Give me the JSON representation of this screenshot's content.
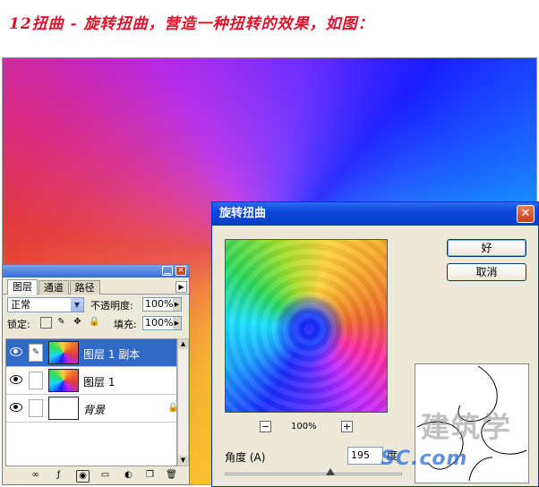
{
  "caption": "12扭曲 - 旋转扭曲，营造一种扭转的效果，如图：",
  "layers_panel": {
    "tabs": [
      "图层",
      "通道",
      "路径"
    ],
    "blend_mode": "正常",
    "opacity_label": "不透明度:",
    "opacity_value": "100%",
    "lock_label": "锁定:",
    "fill_label": "填充:",
    "fill_value": "100%",
    "layers": [
      {
        "name": "图层 1 副本",
        "selected": true
      },
      {
        "name": "图层 1",
        "selected": false
      },
      {
        "name": "背景",
        "selected": false
      }
    ]
  },
  "dialog": {
    "title": "旋转扭曲",
    "ok_label": "好",
    "cancel_label": "取消",
    "zoom_value": "100%",
    "zoom_minus": "−",
    "zoom_plus": "+",
    "angle_label": "角度 (A)",
    "angle_value": "195",
    "angle_unit": "度",
    "angle_slider": {
      "min": -999,
      "max": 999,
      "value": 195
    }
  },
  "watermark": {
    "cn": "建筑学",
    "en": "SC.com"
  },
  "colors": {
    "caption": "#e0102a",
    "selection": "#3169c6",
    "title_bar": "#0b48d8"
  }
}
